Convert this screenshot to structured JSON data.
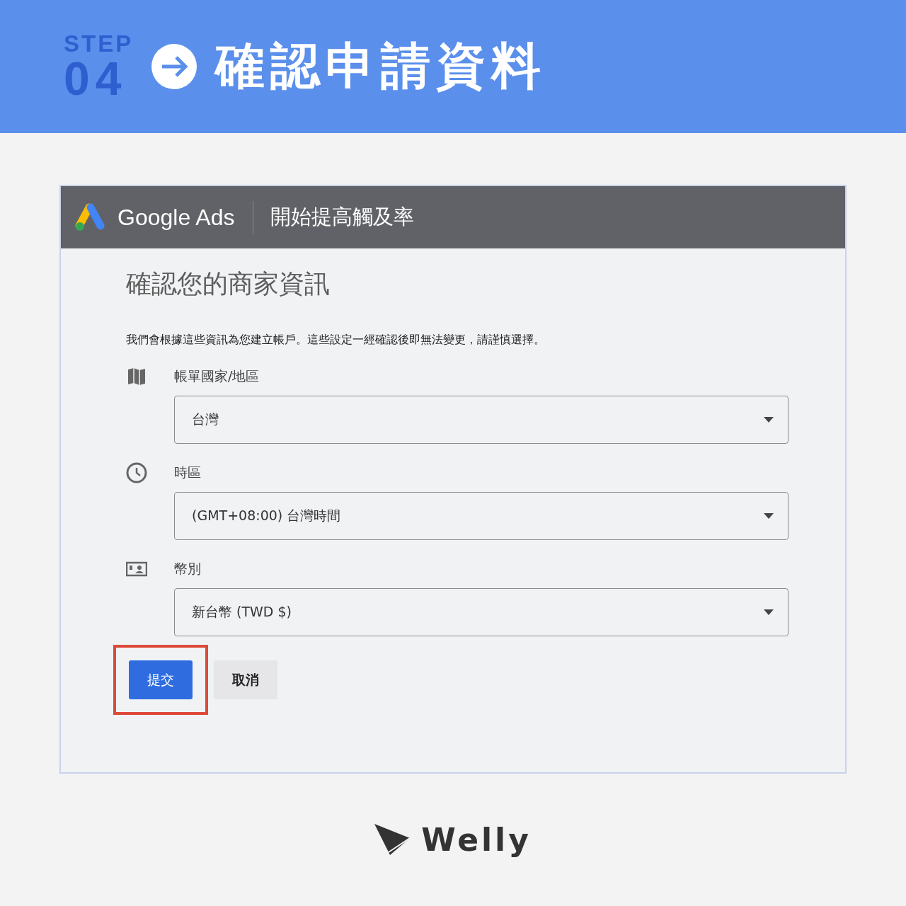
{
  "banner": {
    "step_label": "STEP",
    "step_number": "04",
    "title": "確認申請資料"
  },
  "app_header": {
    "brand": "Google Ads",
    "subtitle": "開始提高觸及率"
  },
  "form": {
    "title": "確認您的商家資訊",
    "description": "我們會根據這些資訊為您建立帳戶。這些設定一經確認後即無法變更，請謹慎選擇。",
    "fields": [
      {
        "kind": "map",
        "label": "帳單國家/地區",
        "value": "台灣"
      },
      {
        "kind": "clock",
        "label": "時區",
        "value": "(GMT+08:00) 台灣時間"
      },
      {
        "kind": "currency",
        "label": "幣別",
        "value": "新台幣 (TWD $)"
      }
    ],
    "buttons": [
      {
        "kind": "primary",
        "label": "提交",
        "highlighted": true
      },
      {
        "kind": "secondary",
        "label": "取消",
        "highlighted": false
      }
    ]
  },
  "footer": {
    "logo_text": "Welly"
  }
}
